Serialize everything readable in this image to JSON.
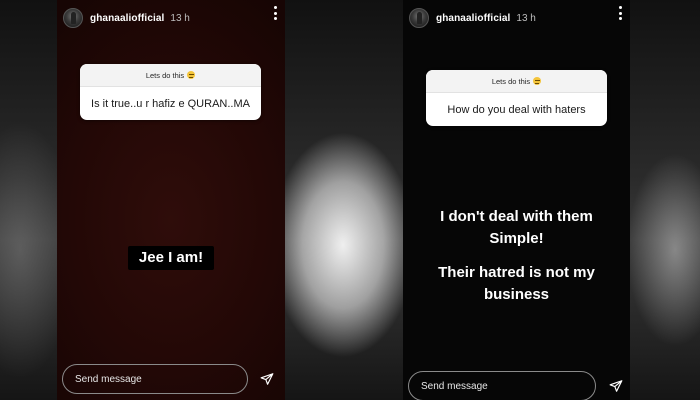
{
  "left_story": {
    "username": "ghanaaliofficial",
    "time": "13 h",
    "question_title": "Lets do this",
    "question_text": "Is it true..u r hafiz e QURAN..MA",
    "answer_text": "Jee I am!",
    "send_placeholder": "Send message"
  },
  "right_story": {
    "username": "ghanaaliofficial",
    "time": "13 h",
    "question_title": "Lets do this",
    "question_text": "How do you  deal with haters",
    "answer_lines": [
      "I don't deal with them",
      "Simple!",
      "",
      "Their hatred is not my",
      "business"
    ],
    "send_placeholder": "Send message"
  },
  "icons": {
    "more": "more-vertical-icon",
    "send": "paper-plane-icon",
    "emoji": "grimacing-face-emoji"
  }
}
